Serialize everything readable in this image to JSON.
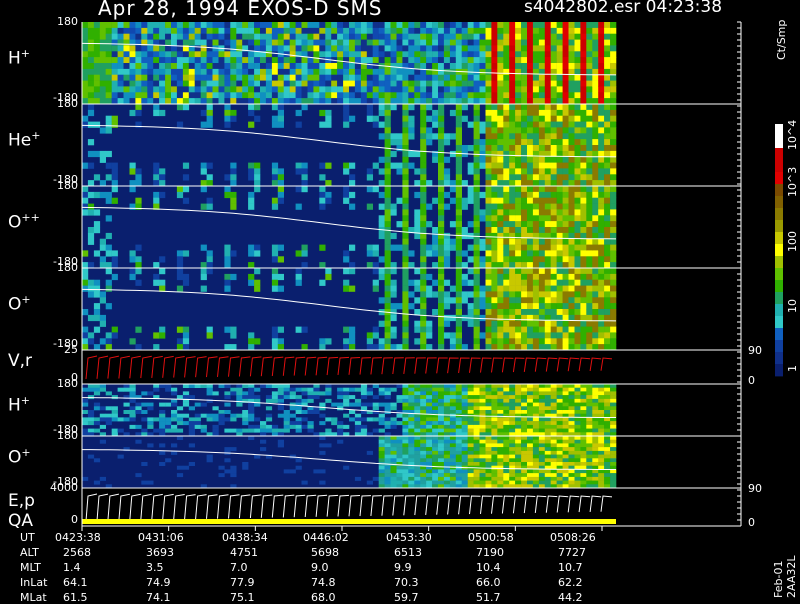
{
  "header": {
    "title": "Apr 28, 1994    EXOS-D SMS",
    "file_time": "s4042802.esr  04:23:38"
  },
  "chart_data": {
    "type": "heatmap",
    "panels": [
      {
        "label_base": "H",
        "label_sup": "+",
        "y_top": "180",
        "y_bottom": "-180",
        "kind": "spectrogram",
        "variant": "hplus"
      },
      {
        "label_base": "He",
        "label_sup": "+",
        "y_top": "180",
        "y_bottom": "-180",
        "kind": "spectrogram",
        "variant": "heplus"
      },
      {
        "label_base": "O",
        "label_sup": "++",
        "y_top": "180",
        "y_bottom": "-180",
        "kind": "spectrogram",
        "variant": "oplusplus"
      },
      {
        "label_base": "O",
        "label_sup": "+",
        "y_top": "180",
        "y_bottom": "-180",
        "kind": "spectrogram",
        "variant": "oplus"
      },
      {
        "label_base": "V,r",
        "label_sup": "",
        "y_top": "25",
        "y_bottom": "0",
        "kind": "line",
        "right_top": "90",
        "right_bottom": "0"
      },
      {
        "label_base": "H",
        "label_sup": "+",
        "y_top": "180",
        "y_bottom": "-180",
        "kind": "spectrogram",
        "variant": "hplus2"
      },
      {
        "label_base": "O",
        "label_sup": "+",
        "y_top": "180",
        "y_bottom": "-180",
        "kind": "spectrogram",
        "variant": "oplus2"
      },
      {
        "label_base": "E,p",
        "label2": "QA",
        "label_sup": "",
        "y_top": "4000",
        "y_bottom": "0",
        "kind": "line",
        "right_top": "90",
        "right_bottom": "0"
      }
    ],
    "colorbar": {
      "unit": "Ct/Smp",
      "labels": [
        "10^4",
        "10^3",
        "100",
        "10",
        "1"
      ],
      "colors": [
        "#ffffff",
        "#ffffff",
        "#cc0000",
        "#cc0000",
        "#e00000",
        "#7a4a00",
        "#806000",
        "#8a7a00",
        "#9a9a00",
        "#c8c800",
        "#ffff00",
        "#a0c000",
        "#60c000",
        "#30b000",
        "#20a060",
        "#20b0b0",
        "#30c8c8",
        "#1060c0",
        "#1040a0",
        "#10308a",
        "#0a1f6e"
      ]
    },
    "time_table": {
      "row_labels": [
        "UT",
        "ALT",
        "MLT",
        "InLat",
        "MLat"
      ],
      "columns": [
        [
          "0423:38",
          "2568",
          "1.4",
          "64.1",
          "61.5"
        ],
        [
          "0431:06",
          "3693",
          "3.5",
          "74.9",
          "74.1"
        ],
        [
          "0438:34",
          "4751",
          "7.0",
          "77.9",
          "75.1"
        ],
        [
          "0446:02",
          "5698",
          "9.0",
          "74.8",
          "68.0"
        ],
        [
          "0453:30",
          "6513",
          "9.9",
          "70.3",
          "59.7"
        ],
        [
          "0500:58",
          "7190",
          "10.4",
          "66.0",
          "51.7"
        ],
        [
          "0508:26",
          "7727",
          "10.7",
          "62.2",
          "44.2"
        ]
      ]
    }
  },
  "footer": {
    "id": "Feb-01 2AA32L"
  }
}
